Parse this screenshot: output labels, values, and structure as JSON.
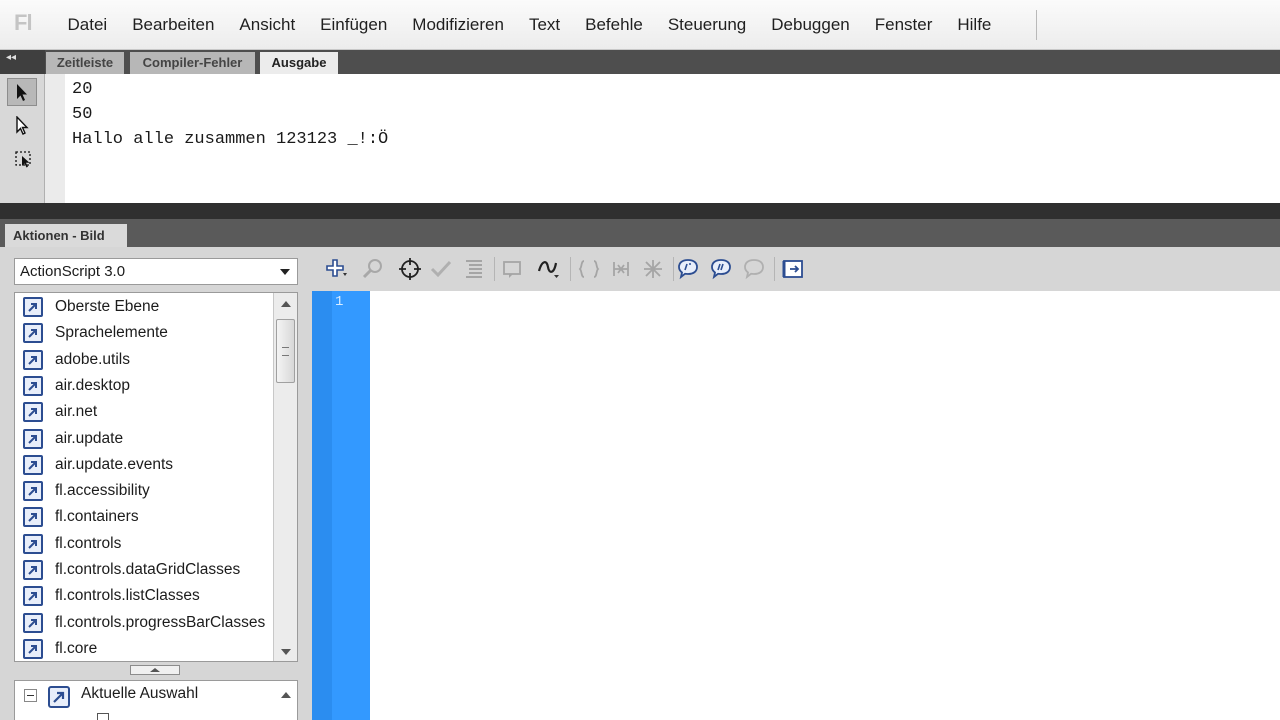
{
  "app": {
    "logo": "Fl"
  },
  "menu": [
    "Datei",
    "Bearbeiten",
    "Ansicht",
    "Einfügen",
    "Modifizieren",
    "Text",
    "Befehle",
    "Steuerung",
    "Debuggen",
    "Fenster",
    "Hilfe"
  ],
  "output_panel": {
    "collapse_label": "◂◂",
    "tabs": [
      "Zeitleiste",
      "Compiler-Fehler",
      "Ausgabe"
    ],
    "active_tab": "Ausgabe",
    "lines": [
      "20",
      "50",
      "Hallo alle zusammen 123123 _!:Ö"
    ]
  },
  "actions_panel": {
    "tab_label": "Aktionen - Bild",
    "language": "ActionScript 3.0",
    "packages": [
      "Oberste Ebene",
      "Sprachelemente",
      "adobe.utils",
      "air.desktop",
      "air.net",
      "air.update",
      "air.update.events",
      "fl.accessibility",
      "fl.containers",
      "fl.controls",
      "fl.controls.dataGridClasses",
      "fl.controls.listClasses",
      "fl.controls.progressBarClasses",
      "fl.core"
    ],
    "selection_tree": {
      "label": "Aktuelle Auswahl"
    },
    "editor": {
      "line_numbers": [
        "1"
      ]
    }
  },
  "colors": {
    "gutter": "#3399ff",
    "icon_blue": "#2c4d91",
    "panel_dark": "#4e4e4e"
  },
  "toolbar_icons": [
    "add-item-icon",
    "find-icon",
    "target-path-icon",
    "check-syntax-icon",
    "auto-format-icon",
    "code-hint-icon",
    "debug-options-icon",
    "collapse-braces-icon",
    "collapse-selection-icon",
    "expand-all-icon",
    "apply-block-comment-icon",
    "apply-line-comment-icon",
    "remove-comment-icon",
    "show-hide-toolbox-icon"
  ]
}
